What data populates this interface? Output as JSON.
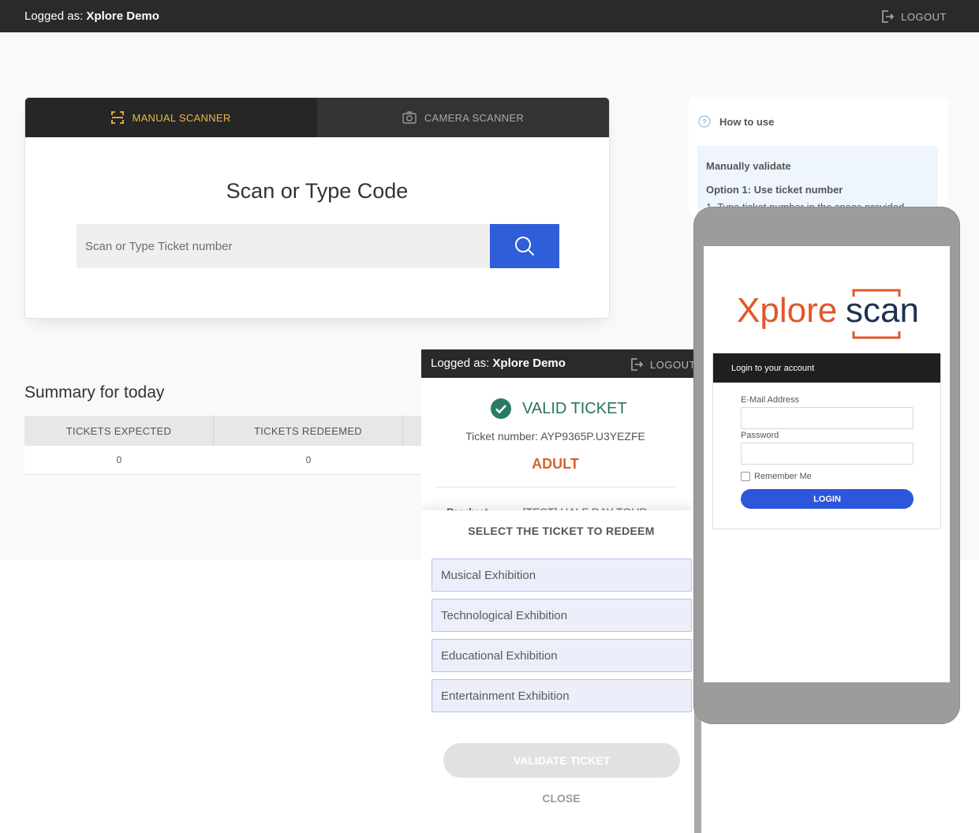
{
  "header": {
    "logged_prefix": "Logged as:",
    "user_name": "Xplore Demo",
    "logout_label": "LOGOUT"
  },
  "scanner": {
    "tabs": [
      {
        "label": "MANUAL SCANNER",
        "icon": "scan-frame-icon",
        "active": true
      },
      {
        "label": "CAMERA SCANNER",
        "icon": "camera-icon",
        "active": false
      }
    ],
    "title": "Scan or Type Code",
    "input_placeholder": "Scan or Type Ticket number",
    "input_value": ""
  },
  "summary": {
    "title": "Summary for today",
    "columns": [
      "TICKETS EXPECTED",
      "TICKETS REDEEMED"
    ],
    "values": [
      "0",
      "0"
    ]
  },
  "howto": {
    "title": "How to use",
    "section": "Manually validate",
    "option1": "Option 1: Use ticket number",
    "step1": "1. Type ticket number in the space provided"
  },
  "ticket_panel": {
    "logged_prefix": "Logged as:",
    "user_name": "Xplore Demo",
    "logout_label": "LOGOUT",
    "status": "VALID TICKET",
    "ticket_number": "Ticket number: AYP9365P.U3YEZFE",
    "ticket_type": "ADULT",
    "product_label": "Product",
    "product_value": "[TEST] HALF DAY TOUR",
    "redeem_title": "SELECT THE TICKET TO REDEEM",
    "options": [
      "Musical Exhibition",
      "Technological Exhibition",
      "Educational Exhibition",
      "Entertainment Exhibition"
    ],
    "validate_label": "VALIDATE TICKET",
    "close_label": "CLOSE"
  },
  "phone": {
    "logo_text_left": "Xplore",
    "logo_text_right": "scan",
    "login_title": "Login to your account",
    "email_label": "E-Mail Address",
    "password_label": "Password",
    "remember_label": "Remember Me",
    "login_button": "LOGIN"
  },
  "colors": {
    "accent_blue": "#2f5ed9",
    "tab_active": "#e9b949",
    "valid_green": "#25745d",
    "ticket_type": "#d1662f",
    "logo_orange": "#e0572a",
    "logo_navy": "#1d3350"
  }
}
